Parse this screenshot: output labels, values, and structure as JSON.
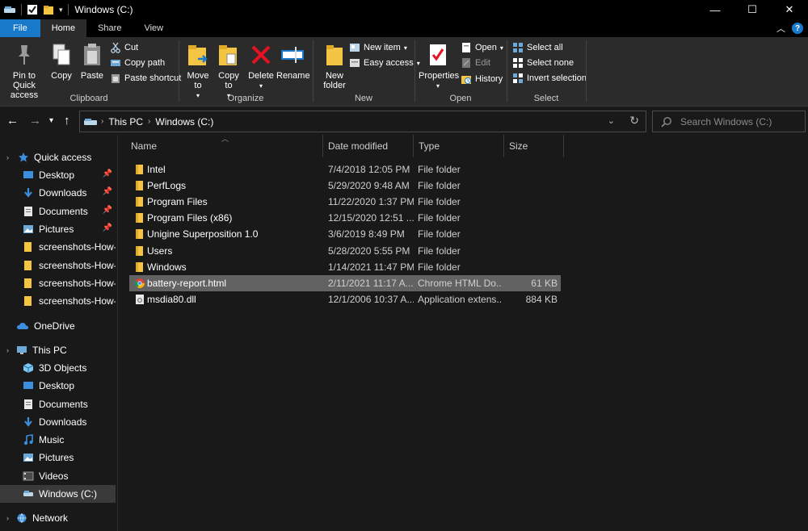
{
  "window": {
    "title": "Windows (C:)",
    "controls": {
      "minimize": "—",
      "maximize": "☐",
      "close": "✕"
    }
  },
  "tabs": [
    "File",
    "Home",
    "Share",
    "View"
  ],
  "active_tab": "Home",
  "ribbon": {
    "clipboard": {
      "label": "Clipboard",
      "pin": "Pin to Quick access",
      "copy": "Copy",
      "paste": "Paste",
      "cut": "Cut",
      "copy_path": "Copy path",
      "paste_shortcut": "Paste shortcut"
    },
    "organize": {
      "label": "Organize",
      "move_to": "Move to",
      "copy_to": "Copy to",
      "delete": "Delete",
      "rename": "Rename"
    },
    "new": {
      "label": "New",
      "new_folder": "New folder",
      "new_item": "New item",
      "easy_access": "Easy access"
    },
    "open": {
      "label": "Open",
      "properties": "Properties",
      "open": "Open",
      "edit": "Edit",
      "history": "History"
    },
    "select": {
      "label": "Select",
      "select_all": "Select all",
      "select_none": "Select none",
      "invert": "Invert selection"
    }
  },
  "address": {
    "crumbs": [
      "This PC",
      "Windows (C:)"
    ],
    "search_placeholder": "Search Windows (C:)"
  },
  "sidebar": {
    "quick_access": "Quick access",
    "quick_items": [
      "Desktop",
      "Downloads",
      "Documents",
      "Pictures",
      "screenshots-How-to",
      "screenshots-How-to",
      "screenshots-How-to",
      "screenshots-How-to"
    ],
    "onedrive": "OneDrive",
    "this_pc": "This PC",
    "pc_items": [
      "3D Objects",
      "Desktop",
      "Documents",
      "Downloads",
      "Music",
      "Pictures",
      "Videos",
      "Windows (C:)"
    ],
    "network": "Network"
  },
  "columns": [
    "Name",
    "Date modified",
    "Type",
    "Size"
  ],
  "files": [
    {
      "name": "Intel",
      "date": "7/4/2018 12:05 PM",
      "type": "File folder",
      "size": "",
      "kind": "folder"
    },
    {
      "name": "PerfLogs",
      "date": "5/29/2020 9:48 AM",
      "type": "File folder",
      "size": "",
      "kind": "folder"
    },
    {
      "name": "Program Files",
      "date": "11/22/2020 1:37 PM",
      "type": "File folder",
      "size": "",
      "kind": "folder"
    },
    {
      "name": "Program Files (x86)",
      "date": "12/15/2020 12:51 ...",
      "type": "File folder",
      "size": "",
      "kind": "folder"
    },
    {
      "name": "Unigine Superposition 1.0",
      "date": "3/6/2019 8:49 PM",
      "type": "File folder",
      "size": "",
      "kind": "folder"
    },
    {
      "name": "Users",
      "date": "5/28/2020 5:55 PM",
      "type": "File folder",
      "size": "",
      "kind": "folder"
    },
    {
      "name": "Windows",
      "date": "1/14/2021 11:47 PM",
      "type": "File folder",
      "size": "",
      "kind": "folder"
    },
    {
      "name": "battery-report.html",
      "date": "2/11/2021 11:17 A...",
      "type": "Chrome HTML Do...",
      "size": "61 KB",
      "kind": "chrome"
    },
    {
      "name": "msdia80.dll",
      "date": "12/1/2006 10:37 A...",
      "type": "Application extens...",
      "size": "884 KB",
      "kind": "dll"
    }
  ],
  "colors": {
    "accent": "#1979ca",
    "folder": "#f4c542",
    "delete": "#e81123",
    "selection": "#626262"
  }
}
